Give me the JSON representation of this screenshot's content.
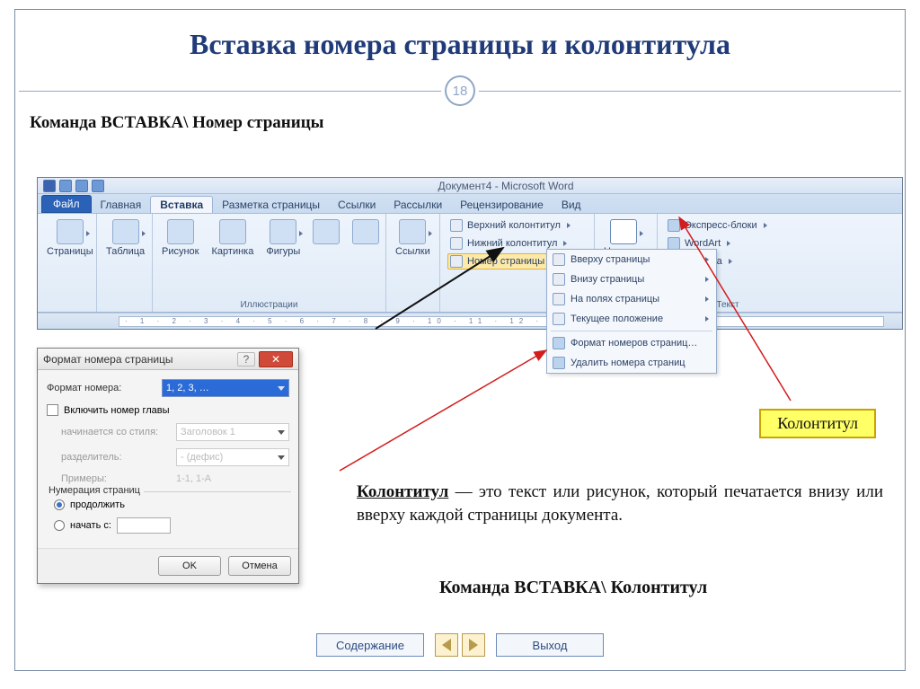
{
  "slide": {
    "title": "Вставка номера страницы и колонтитула",
    "page_number": "18",
    "command1": "Команда  ВСТАВКА\\ Номер страницы",
    "command2": "Команда  ВСТАВКА\\ Колонтитул"
  },
  "word": {
    "title": "Документ4 - Microsoft Word",
    "tabs": {
      "file": "Файл",
      "home": "Главная",
      "insert": "Вставка",
      "layout": "Разметка страницы",
      "refs": "Ссылки",
      "mail": "Рассылки",
      "review": "Рецензирование",
      "view": "Вид"
    },
    "groups": {
      "pages": "Страницы",
      "tables": "Таблица",
      "illustrations": "Иллюстрации",
      "links": "Ссылки",
      "header_footer": "",
      "text": "Текст"
    },
    "ill_btns": {
      "picture": "Рисунок",
      "clipart": "Картинка",
      "shapes": "Фигуры"
    },
    "hf_btns": {
      "header": "Верхний колонтитул",
      "footer": "Нижний колонтитул",
      "pagenum": "Номер страницы"
    },
    "text_btns": {
      "textbox": "Надпись",
      "quick": "Экспресс-блоки",
      "wordart": "WordArt",
      "dropcap": "Буквица"
    }
  },
  "dd": {
    "top": "Вверху страницы",
    "bottom": "Внизу страницы",
    "margins": "На полях страницы",
    "current": "Текущее положение",
    "format": "Формат номеров страниц…",
    "remove": "Удалить номера страниц"
  },
  "dlg": {
    "title": "Формат номера страницы",
    "format_label": "Формат номера:",
    "format_value": "1, 2, 3, …",
    "include_chapter": "Включить номер главы",
    "starts_with_style": "начинается со стиля:",
    "starts_with_style_value": "Заголовок 1",
    "separator": "разделитель:",
    "separator_value": "-   (дефис)",
    "examples": "Примеры:",
    "examples_value": "1-1, 1-A",
    "numbering": "Нумерация страниц",
    "radio_continue": "продолжить",
    "radio_start": "начать с:",
    "ok": "OK",
    "cancel": "Отмена"
  },
  "callout": {
    "label": "Колонтитул"
  },
  "para": {
    "term": "Колонтитул",
    "rest": " — это текст или рисунок, который печатается внизу или вверху каждой страницы документа."
  },
  "nav": {
    "contents": "Содержание",
    "exit": "Выход"
  }
}
